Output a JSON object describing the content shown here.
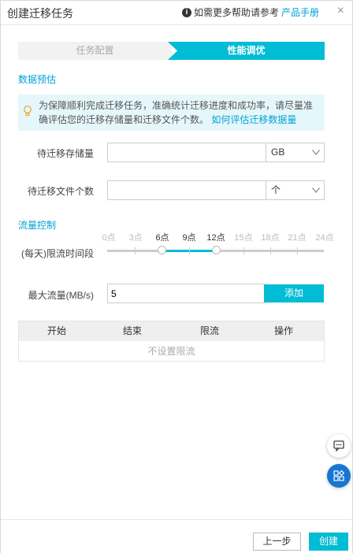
{
  "header": {
    "title": "创建迁移任务",
    "help_text": "如需更多帮助请参考",
    "help_link": "产品手册",
    "close_glyph": "×"
  },
  "steps": [
    {
      "label": "任务配置",
      "active": false
    },
    {
      "label": "性能调优",
      "active": true
    }
  ],
  "estimate": {
    "section_title": "数据预估",
    "notice_text": "为保障顺利完成迁移任务，准确统计迁移进度和成功率，请尽量准确评估您的迁移存储量和迁移文件个数。",
    "notice_link": "如何评估迁移数据量",
    "storage_label": "待迁移存储量",
    "storage_value": "",
    "storage_unit": "GB",
    "file_count_label": "待迁移文件个数",
    "file_count_value": "",
    "file_count_unit": "个"
  },
  "flow": {
    "section_title": "流量控制",
    "time_label": "(每天)限流时间段",
    "ticks": [
      "0点",
      "3点",
      "6点",
      "9点",
      "12点",
      "15点",
      "18点",
      "21点",
      "24点"
    ],
    "range_start_hour": 6,
    "range_end_hour": 12,
    "max_flow_label": "最大流量(MB/s)",
    "max_flow_value": "5",
    "add_label": "添加"
  },
  "table": {
    "headers": [
      "开始",
      "结束",
      "限流",
      "操作"
    ],
    "empty_text": "不设置限流"
  },
  "footer": {
    "prev_label": "上一步",
    "create_label": "创建"
  },
  "colors": {
    "accent": "#00bcd4",
    "link": "#00a1d6",
    "float_button": "#1677d2"
  }
}
